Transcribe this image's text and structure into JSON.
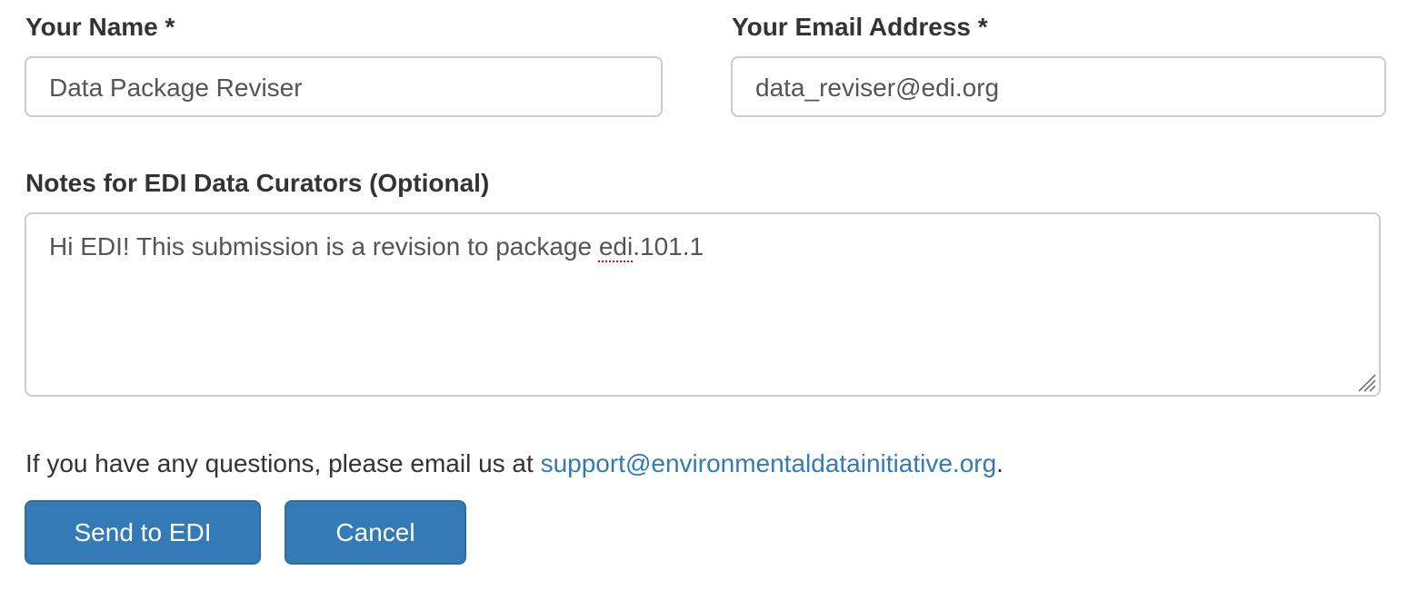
{
  "form": {
    "name": {
      "label": "Your Name *",
      "value": "Data Package Reviser"
    },
    "email": {
      "label": "Your Email Address *",
      "value": "data_reviser@edi.org"
    },
    "notes": {
      "label": "Notes for EDI Data Curators (Optional)",
      "value_before": "Hi EDI! This submission is a revision to package ",
      "value_misspelled": "edi",
      "value_after": ".101.1"
    }
  },
  "help": {
    "text": "If you have any questions, please email us at ",
    "link": "support@environmentaldatainitiative.org",
    "suffix": "."
  },
  "buttons": {
    "send_label": "Send to EDI",
    "cancel_label": "Cancel"
  },
  "colors": {
    "primary": "#337ab7",
    "link": "#337ab7",
    "spellcheck": "#d0021b"
  },
  "icons": {
    "resize_handle": "resize-handle-icon"
  }
}
